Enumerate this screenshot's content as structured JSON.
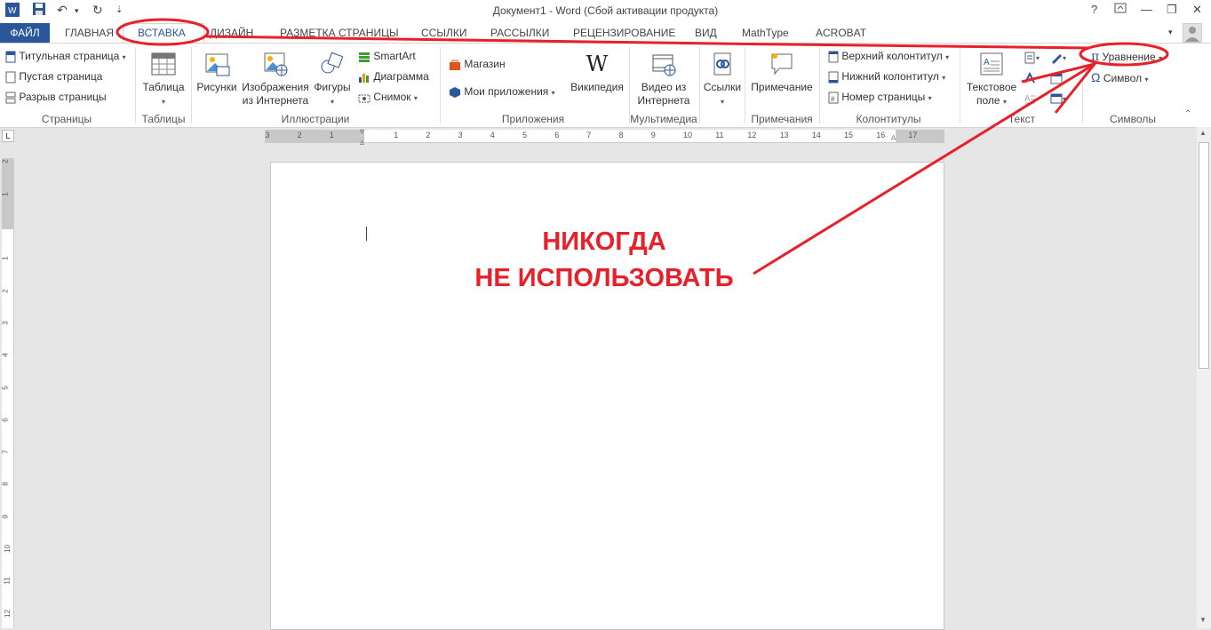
{
  "window": {
    "title": "Документ1 - Word (Сбой активации продукта)",
    "help": "?",
    "minimize": "—",
    "restore": "❐",
    "close": "✕"
  },
  "qat": {
    "word_icon": "W",
    "save": "💾",
    "undo": "↶",
    "redo": "↻",
    "customize": "⇣"
  },
  "tabs": {
    "file": "ФАЙЛ",
    "items": [
      "ГЛАВНАЯ",
      "ВСТАВКА",
      "ДИЗАЙН",
      "РАЗМЕТКА СТРАНИЦЫ",
      "ССЫЛКИ",
      "РАССЫЛКИ",
      "РЕЦЕНЗИРОВАНИЕ",
      "ВИД",
      "MathType",
      "ACROBAT"
    ],
    "active": "ВСТАВКА"
  },
  "ribbon": {
    "pages": {
      "label": "Страницы",
      "cover": "Титульная страница",
      "blank": "Пустая страница",
      "break": "Разрыв страницы"
    },
    "tables": {
      "label": "Таблицы",
      "table": "Таблица"
    },
    "illustrations": {
      "label": "Иллюстрации",
      "pictures": "Рисунки",
      "online_line1": "Изображения",
      "online_line2": "из Интернета",
      "shapes": "Фигуры",
      "smartart": "SmartArt",
      "chart": "Диаграмма",
      "screenshot": "Снимок"
    },
    "apps": {
      "label": "Приложения",
      "store": "Магазин",
      "myapps": "Мои приложения",
      "wikipedia": "Википедия"
    },
    "media": {
      "label": "Мультимедиа",
      "video_line1": "Видео из",
      "video_line2": "Интернета"
    },
    "links": {
      "label": "",
      "links": "Ссылки"
    },
    "comments": {
      "label": "Примечания",
      "comment": "Примечание"
    },
    "header_footer": {
      "label": "Колонтитулы",
      "header": "Верхний колонтитул",
      "footer": "Нижний колонтитул",
      "page_number": "Номер страницы"
    },
    "text": {
      "label": "Текст",
      "textbox_line1": "Текстовое",
      "textbox_line2": "поле"
    },
    "symbols": {
      "label": "Символы",
      "equation": "Уравнение",
      "symbol": "Символ"
    }
  },
  "ruler": {
    "h_ticks": [
      "3",
      "2",
      "1",
      "1",
      "2",
      "3",
      "4",
      "5",
      "6",
      "7",
      "8",
      "9",
      "10",
      "11",
      "12",
      "13",
      "14",
      "15",
      "16",
      "17"
    ],
    "v_ticks": [
      "2",
      "1",
      "1",
      "2",
      "3",
      "4",
      "5",
      "6",
      "7",
      "8",
      "9",
      "10",
      "11",
      "12"
    ]
  },
  "annotation": {
    "line1": "НИКОГДА",
    "line2": "НЕ ИСПОЛЬЗОВАТЬ",
    "color": "#e8202a"
  },
  "colors": {
    "file_tab": "#2b579a",
    "accent": "#2b579a",
    "annotation": "#e8202a"
  }
}
